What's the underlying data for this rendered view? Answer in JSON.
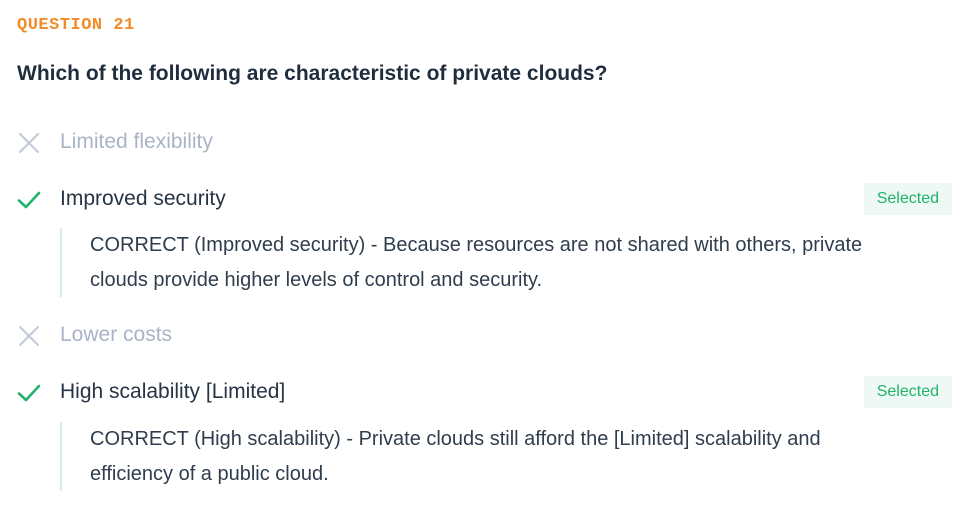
{
  "question": {
    "number_label": "QUESTION 21",
    "text": "Which of the following are characteristic of private clouds?"
  },
  "options": [
    {
      "label": "Limited flexibility",
      "status": "incorrect",
      "icon": "x-icon"
    },
    {
      "label": "Improved security",
      "status": "correct",
      "icon": "check-icon",
      "badge": "Selected",
      "explanation": "CORRECT (Improved security) - Because resources are not shared with others, private clouds provide higher levels of control and security."
    },
    {
      "label": "Lower costs",
      "status": "incorrect",
      "icon": "x-icon"
    },
    {
      "label": "High scalability [Limited]",
      "status": "correct",
      "icon": "check-icon",
      "badge": "Selected",
      "explanation": "CORRECT (High scalability) - Private clouds still afford the [Limited] scalability and efficiency of a public cloud."
    }
  ],
  "colors": {
    "accent": "#f28c28",
    "correct": "#21b36a",
    "incorrect": "#c3cbd8",
    "badge_bg": "#eef8f4"
  }
}
